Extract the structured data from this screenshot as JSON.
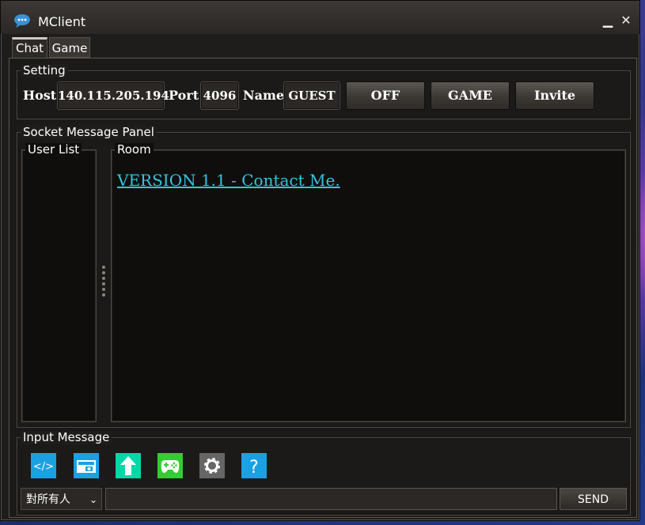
{
  "window": {
    "title": "MClient",
    "minimize_icon": "minimize-icon",
    "close_icon": "close-icon",
    "minimize_glyph": "▁",
    "close_glyph": "✕"
  },
  "tabs": [
    {
      "label": "Chat",
      "active": true
    },
    {
      "label": "Game",
      "active": false
    }
  ],
  "setting": {
    "group_label": "Setting",
    "host_label": "Host",
    "host_value": "140.115.205.194",
    "port_label": "Port",
    "port_value": "4096",
    "name_label": "Name",
    "name_value": "GUEST",
    "buttons": {
      "off": "OFF",
      "game": "GAME",
      "invite": "Invite"
    }
  },
  "socket_panel": {
    "group_label": "Socket Message Panel",
    "user_list_label": "User List",
    "room_label": "Room",
    "room_message": "VERSION 1.1 - Contact Me."
  },
  "input_message": {
    "group_label": "Input Message",
    "icons": [
      "code-icon",
      "pictures-icon",
      "upload-icon",
      "gamepad-icon",
      "settings-icon",
      "help-icon"
    ],
    "recipient_select": "對所有人",
    "message_value": "",
    "send_label": "SEND"
  },
  "colors": {
    "accent_cyan": "#33c5e0",
    "icon_blue": "#1ba1e2",
    "icon_teal": "#00d8a8",
    "icon_green": "#33cc33",
    "icon_gray": "#666666"
  }
}
